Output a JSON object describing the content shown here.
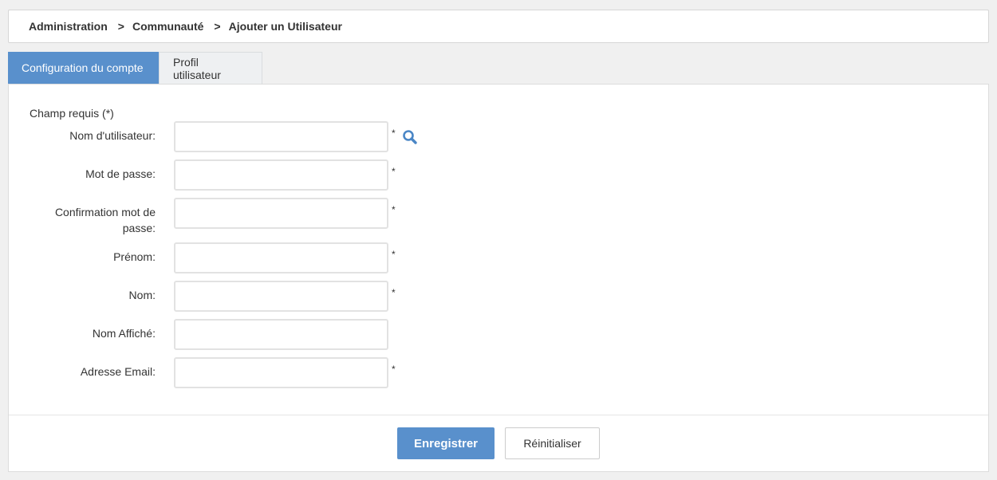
{
  "breadcrumb": {
    "items": [
      "Administration",
      "Communauté",
      "Ajouter un Utilisateur"
    ],
    "separator": ">"
  },
  "tabs": [
    {
      "label": "Configuration du compte",
      "active": true
    },
    {
      "label": "Profil utilisateur",
      "active": false
    }
  ],
  "form": {
    "required_note": "Champ requis (*)",
    "required_marker": "*",
    "fields": [
      {
        "label": "Nom d'utilisateur:",
        "value": "",
        "required": true,
        "search": true
      },
      {
        "label": "Mot de passe:",
        "value": "",
        "required": true
      },
      {
        "label": "Confirmation mot de passe:",
        "value": "",
        "required": true
      },
      {
        "label": "Prénom:",
        "value": "",
        "required": true
      },
      {
        "label": "Nom:",
        "value": "",
        "required": true
      },
      {
        "label": "Nom Affiché:",
        "value": "",
        "required": false
      },
      {
        "label": "Adresse Email:",
        "value": "",
        "required": true
      }
    ]
  },
  "buttons": {
    "save_label": "Enregistrer",
    "reset_label": "Réinitialiser"
  },
  "colors": {
    "accent": "#5990cc",
    "search_icon": "#4a86c6"
  },
  "icons": {
    "search": "search-icon"
  }
}
